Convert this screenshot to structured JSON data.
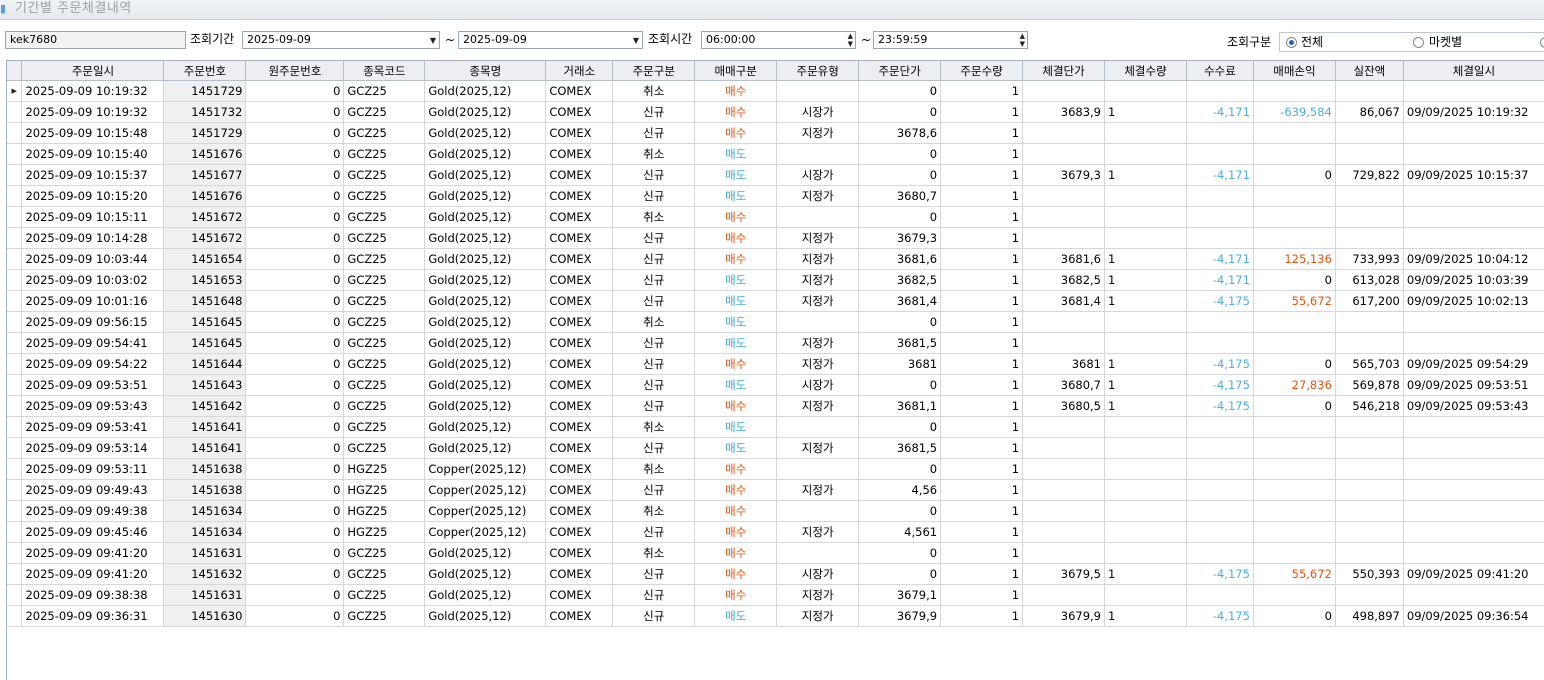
{
  "window": {
    "title": "기간별 주문체결내역"
  },
  "filters": {
    "account": "kek7680",
    "period_label": "조회기간",
    "date_from": "2025-09-09",
    "tilde": "~",
    "date_to": "2025-09-09",
    "time_label": "조회시간",
    "time_from": "06:00:00",
    "time_to": "23:59:59",
    "type_label": "조회구분",
    "radio_all": "전체",
    "radio_market": "마켓별",
    "selected_radio": "전체"
  },
  "colors": {
    "buy": "#e8520c",
    "sell": "#3aa7de",
    "loss": "#4aaee4",
    "profit": "#e8520c",
    "selected_radio": "#2a62b8"
  },
  "table": {
    "columns": [
      "주문일시",
      "주문번호",
      "원주문번호",
      "종목코드",
      "종목명",
      "거래소",
      "주문구분",
      "매매구분",
      "주문유형",
      "주문단가",
      "주문수량",
      "체결단가",
      "체결수량",
      "수수료",
      "매매손익",
      "실잔액",
      "체결일시"
    ],
    "rows": [
      {
        "t": "2025-09-09 10:19:32",
        "no": "1451729",
        "orig": "0",
        "code": "GCZ25",
        "name": "Gold(2025,12)",
        "ex": "COMEX",
        "kind": "취소",
        "side": "매수",
        "otype": "",
        "oprice": "0",
        "oqty": "1",
        "fprice": "",
        "fqty": "",
        "fee": "",
        "pnl": "",
        "bal": "",
        "ftime": ""
      },
      {
        "t": "2025-09-09 10:19:32",
        "no": "1451732",
        "orig": "0",
        "code": "GCZ25",
        "name": "Gold(2025,12)",
        "ex": "COMEX",
        "kind": "신규",
        "side": "매수",
        "otype": "시장가",
        "oprice": "0",
        "oqty": "1",
        "fprice": "3683,9",
        "fqty": "1",
        "fee": "-4,171",
        "pnl": "-639,584",
        "bal": "86,067",
        "ftime": "09/09/2025 10:19:32"
      },
      {
        "t": "2025-09-09 10:15:48",
        "no": "1451729",
        "orig": "0",
        "code": "GCZ25",
        "name": "Gold(2025,12)",
        "ex": "COMEX",
        "kind": "신규",
        "side": "매수",
        "otype": "지정가",
        "oprice": "3678,6",
        "oqty": "1",
        "fprice": "",
        "fqty": "",
        "fee": "",
        "pnl": "",
        "bal": "",
        "ftime": ""
      },
      {
        "t": "2025-09-09 10:15:40",
        "no": "1451676",
        "orig": "0",
        "code": "GCZ25",
        "name": "Gold(2025,12)",
        "ex": "COMEX",
        "kind": "취소",
        "side": "매도",
        "otype": "",
        "oprice": "0",
        "oqty": "1",
        "fprice": "",
        "fqty": "",
        "fee": "",
        "pnl": "",
        "bal": "",
        "ftime": ""
      },
      {
        "t": "2025-09-09 10:15:37",
        "no": "1451677",
        "orig": "0",
        "code": "GCZ25",
        "name": "Gold(2025,12)",
        "ex": "COMEX",
        "kind": "신규",
        "side": "매도",
        "otype": "시장가",
        "oprice": "0",
        "oqty": "1",
        "fprice": "3679,3",
        "fqty": "1",
        "fee": "-4,171",
        "pnl": "0",
        "bal": "729,822",
        "ftime": "09/09/2025 10:15:37"
      },
      {
        "t": "2025-09-09 10:15:20",
        "no": "1451676",
        "orig": "0",
        "code": "GCZ25",
        "name": "Gold(2025,12)",
        "ex": "COMEX",
        "kind": "신규",
        "side": "매도",
        "otype": "지정가",
        "oprice": "3680,7",
        "oqty": "1",
        "fprice": "",
        "fqty": "",
        "fee": "",
        "pnl": "",
        "bal": "",
        "ftime": ""
      },
      {
        "t": "2025-09-09 10:15:11",
        "no": "1451672",
        "orig": "0",
        "code": "GCZ25",
        "name": "Gold(2025,12)",
        "ex": "COMEX",
        "kind": "취소",
        "side": "매수",
        "otype": "",
        "oprice": "0",
        "oqty": "1",
        "fprice": "",
        "fqty": "",
        "fee": "",
        "pnl": "",
        "bal": "",
        "ftime": ""
      },
      {
        "t": "2025-09-09 10:14:28",
        "no": "1451672",
        "orig": "0",
        "code": "GCZ25",
        "name": "Gold(2025,12)",
        "ex": "COMEX",
        "kind": "신규",
        "side": "매수",
        "otype": "지정가",
        "oprice": "3679,3",
        "oqty": "1",
        "fprice": "",
        "fqty": "",
        "fee": "",
        "pnl": "",
        "bal": "",
        "ftime": ""
      },
      {
        "t": "2025-09-09 10:03:44",
        "no": "1451654",
        "orig": "0",
        "code": "GCZ25",
        "name": "Gold(2025,12)",
        "ex": "COMEX",
        "kind": "신규",
        "side": "매수",
        "otype": "지정가",
        "oprice": "3681,6",
        "oqty": "1",
        "fprice": "3681,6",
        "fqty": "1",
        "fee": "-4,171",
        "pnl": "125,136",
        "bal": "733,993",
        "ftime": "09/09/2025 10:04:12"
      },
      {
        "t": "2025-09-09 10:03:02",
        "no": "1451653",
        "orig": "0",
        "code": "GCZ25",
        "name": "Gold(2025,12)",
        "ex": "COMEX",
        "kind": "신규",
        "side": "매도",
        "otype": "지정가",
        "oprice": "3682,5",
        "oqty": "1",
        "fprice": "3682,5",
        "fqty": "1",
        "fee": "-4,171",
        "pnl": "0",
        "bal": "613,028",
        "ftime": "09/09/2025 10:03:39"
      },
      {
        "t": "2025-09-09 10:01:16",
        "no": "1451648",
        "orig": "0",
        "code": "GCZ25",
        "name": "Gold(2025,12)",
        "ex": "COMEX",
        "kind": "신규",
        "side": "매도",
        "otype": "지정가",
        "oprice": "3681,4",
        "oqty": "1",
        "fprice": "3681,4",
        "fqty": "1",
        "fee": "-4,175",
        "pnl": "55,672",
        "bal": "617,200",
        "ftime": "09/09/2025 10:02:13"
      },
      {
        "t": "2025-09-09 09:56:15",
        "no": "1451645",
        "orig": "0",
        "code": "GCZ25",
        "name": "Gold(2025,12)",
        "ex": "COMEX",
        "kind": "취소",
        "side": "매도",
        "otype": "",
        "oprice": "0",
        "oqty": "1",
        "fprice": "",
        "fqty": "",
        "fee": "",
        "pnl": "",
        "bal": "",
        "ftime": ""
      },
      {
        "t": "2025-09-09 09:54:41",
        "no": "1451645",
        "orig": "0",
        "code": "GCZ25",
        "name": "Gold(2025,12)",
        "ex": "COMEX",
        "kind": "신규",
        "side": "매도",
        "otype": "지정가",
        "oprice": "3681,5",
        "oqty": "1",
        "fprice": "",
        "fqty": "",
        "fee": "",
        "pnl": "",
        "bal": "",
        "ftime": ""
      },
      {
        "t": "2025-09-09 09:54:22",
        "no": "1451644",
        "orig": "0",
        "code": "GCZ25",
        "name": "Gold(2025,12)",
        "ex": "COMEX",
        "kind": "신규",
        "side": "매수",
        "otype": "지정가",
        "oprice": "3681",
        "oqty": "1",
        "fprice": "3681",
        "fqty": "1",
        "fee": "-4,175",
        "pnl": "0",
        "bal": "565,703",
        "ftime": "09/09/2025 09:54:29"
      },
      {
        "t": "2025-09-09 09:53:51",
        "no": "1451643",
        "orig": "0",
        "code": "GCZ25",
        "name": "Gold(2025,12)",
        "ex": "COMEX",
        "kind": "신규",
        "side": "매도",
        "otype": "시장가",
        "oprice": "0",
        "oqty": "1",
        "fprice": "3680,7",
        "fqty": "1",
        "fee": "-4,175",
        "pnl": "27,836",
        "bal": "569,878",
        "ftime": "09/09/2025 09:53:51"
      },
      {
        "t": "2025-09-09 09:53:43",
        "no": "1451642",
        "orig": "0",
        "code": "GCZ25",
        "name": "Gold(2025,12)",
        "ex": "COMEX",
        "kind": "신규",
        "side": "매수",
        "otype": "지정가",
        "oprice": "3681,1",
        "oqty": "1",
        "fprice": "3680,5",
        "fqty": "1",
        "fee": "-4,175",
        "pnl": "0",
        "bal": "546,218",
        "ftime": "09/09/2025 09:53:43"
      },
      {
        "t": "2025-09-09 09:53:41",
        "no": "1451641",
        "orig": "0",
        "code": "GCZ25",
        "name": "Gold(2025,12)",
        "ex": "COMEX",
        "kind": "취소",
        "side": "매도",
        "otype": "",
        "oprice": "0",
        "oqty": "1",
        "fprice": "",
        "fqty": "",
        "fee": "",
        "pnl": "",
        "bal": "",
        "ftime": ""
      },
      {
        "t": "2025-09-09 09:53:14",
        "no": "1451641",
        "orig": "0",
        "code": "GCZ25",
        "name": "Gold(2025,12)",
        "ex": "COMEX",
        "kind": "신규",
        "side": "매도",
        "otype": "지정가",
        "oprice": "3681,5",
        "oqty": "1",
        "fprice": "",
        "fqty": "",
        "fee": "",
        "pnl": "",
        "bal": "",
        "ftime": ""
      },
      {
        "t": "2025-09-09 09:53:11",
        "no": "1451638",
        "orig": "0",
        "code": "HGZ25",
        "name": "Copper(2025,12)",
        "ex": "COMEX",
        "kind": "취소",
        "side": "매수",
        "otype": "",
        "oprice": "0",
        "oqty": "1",
        "fprice": "",
        "fqty": "",
        "fee": "",
        "pnl": "",
        "bal": "",
        "ftime": ""
      },
      {
        "t": "2025-09-09 09:49:43",
        "no": "1451638",
        "orig": "0",
        "code": "HGZ25",
        "name": "Copper(2025,12)",
        "ex": "COMEX",
        "kind": "신규",
        "side": "매수",
        "otype": "지정가",
        "oprice": "4,56",
        "oqty": "1",
        "fprice": "",
        "fqty": "",
        "fee": "",
        "pnl": "",
        "bal": "",
        "ftime": ""
      },
      {
        "t": "2025-09-09 09:49:38",
        "no": "1451634",
        "orig": "0",
        "code": "HGZ25",
        "name": "Copper(2025,12)",
        "ex": "COMEX",
        "kind": "취소",
        "side": "매수",
        "otype": "",
        "oprice": "0",
        "oqty": "1",
        "fprice": "",
        "fqty": "",
        "fee": "",
        "pnl": "",
        "bal": "",
        "ftime": ""
      },
      {
        "t": "2025-09-09 09:45:46",
        "no": "1451634",
        "orig": "0",
        "code": "HGZ25",
        "name": "Copper(2025,12)",
        "ex": "COMEX",
        "kind": "신규",
        "side": "매수",
        "otype": "지정가",
        "oprice": "4,561",
        "oqty": "1",
        "fprice": "",
        "fqty": "",
        "fee": "",
        "pnl": "",
        "bal": "",
        "ftime": ""
      },
      {
        "t": "2025-09-09 09:41:20",
        "no": "1451631",
        "orig": "0",
        "code": "GCZ25",
        "name": "Gold(2025,12)",
        "ex": "COMEX",
        "kind": "취소",
        "side": "매수",
        "otype": "",
        "oprice": "0",
        "oqty": "1",
        "fprice": "",
        "fqty": "",
        "fee": "",
        "pnl": "",
        "bal": "",
        "ftime": ""
      },
      {
        "t": "2025-09-09 09:41:20",
        "no": "1451632",
        "orig": "0",
        "code": "GCZ25",
        "name": "Gold(2025,12)",
        "ex": "COMEX",
        "kind": "신규",
        "side": "매수",
        "otype": "시장가",
        "oprice": "0",
        "oqty": "1",
        "fprice": "3679,5",
        "fqty": "1",
        "fee": "-4,175",
        "pnl": "55,672",
        "bal": "550,393",
        "ftime": "09/09/2025 09:41:20"
      },
      {
        "t": "2025-09-09 09:38:38",
        "no": "1451631",
        "orig": "0",
        "code": "GCZ25",
        "name": "Gold(2025,12)",
        "ex": "COMEX",
        "kind": "신규",
        "side": "매수",
        "otype": "지정가",
        "oprice": "3679,1",
        "oqty": "1",
        "fprice": "",
        "fqty": "",
        "fee": "",
        "pnl": "",
        "bal": "",
        "ftime": ""
      },
      {
        "t": "2025-09-09 09:36:31",
        "no": "1451630",
        "orig": "0",
        "code": "GCZ25",
        "name": "Gold(2025,12)",
        "ex": "COMEX",
        "kind": "신규",
        "side": "매도",
        "otype": "지정가",
        "oprice": "3679,9",
        "oqty": "1",
        "fprice": "3679,9",
        "fqty": "1",
        "fee": "-4,175",
        "pnl": "0",
        "bal": "498,897",
        "ftime": "09/09/2025 09:36:54"
      }
    ]
  }
}
